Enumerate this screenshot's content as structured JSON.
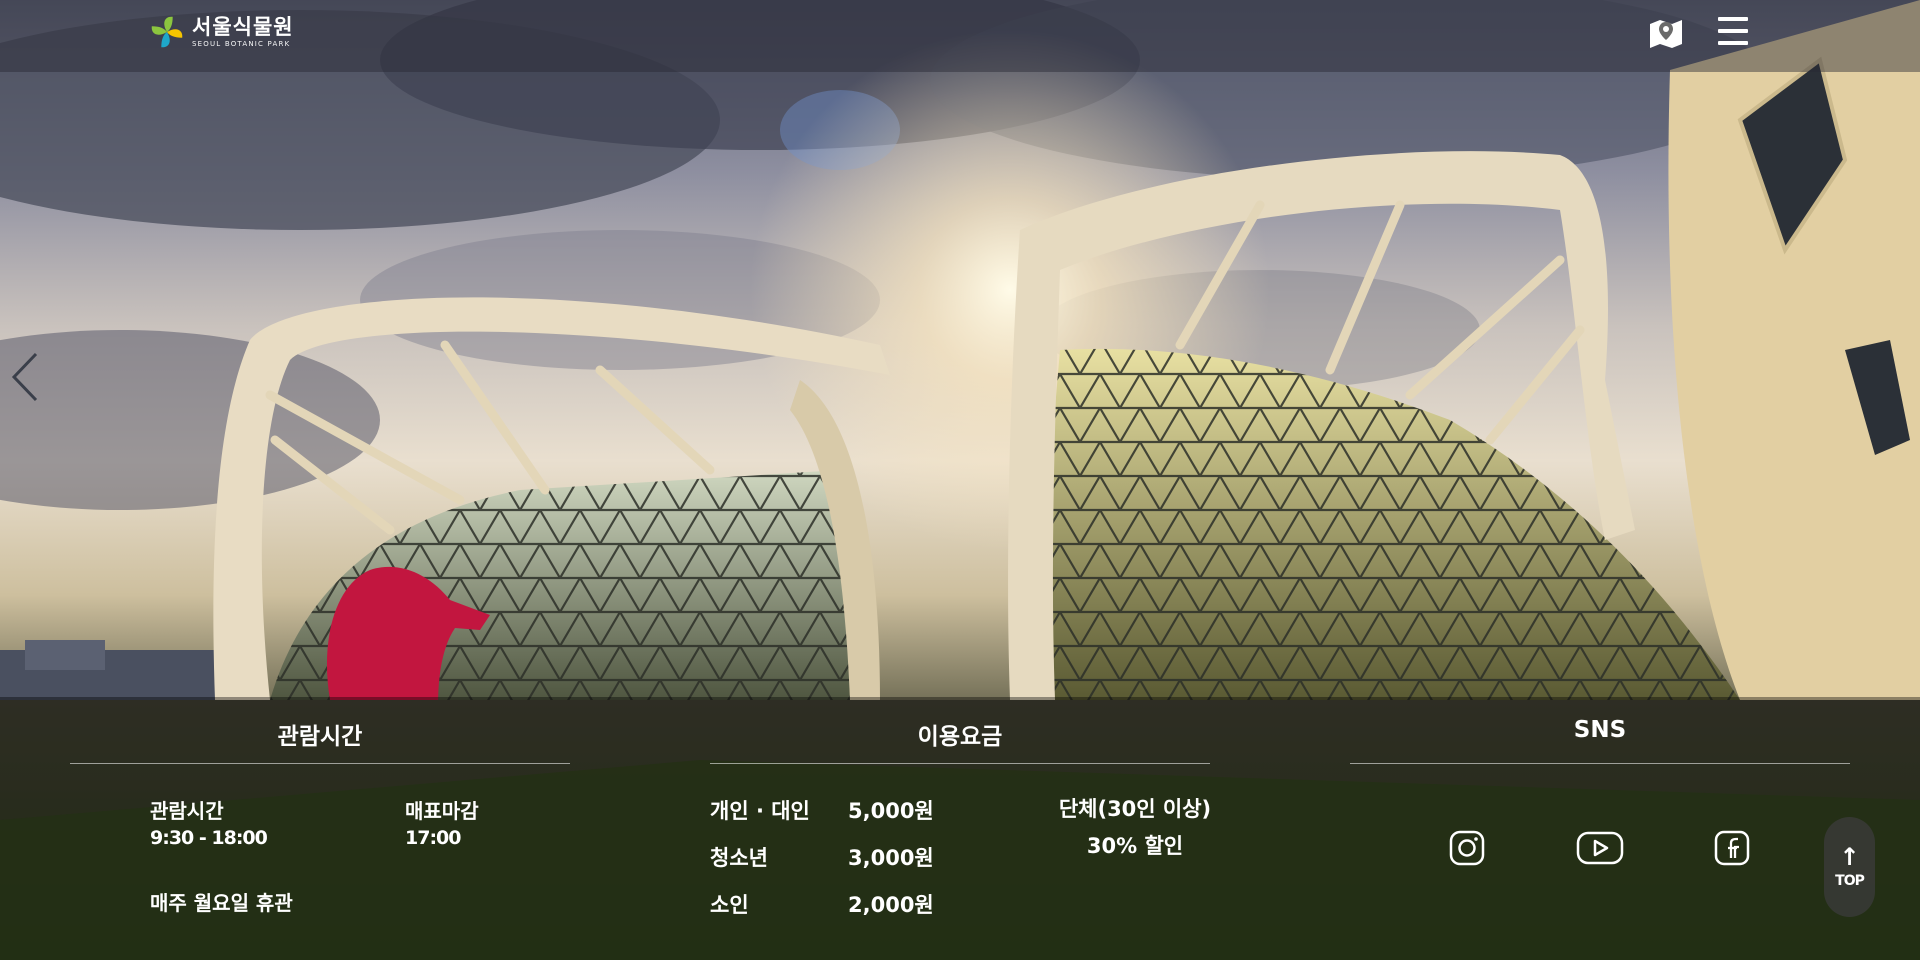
{
  "brand": {
    "name_ko": "서울식물원",
    "name_en": "SEOUL BOTANIC PARK",
    "accent_colors": [
      "#8cc63f",
      "#f5c400",
      "#1fa7c9"
    ]
  },
  "header": {
    "map_icon": "map-icon",
    "menu_icon": "hamburger-menu-icon"
  },
  "slider": {
    "prev_icon": "chevron-left-icon"
  },
  "hours": {
    "title": "관람시간",
    "open_label": "관람시간",
    "open_value": "9:30 - 18:00",
    "ticket_label": "매표마감",
    "ticket_value": "17:00",
    "closed_note": "매주 월요일 휴관"
  },
  "fees": {
    "title": "이용요금",
    "rows": [
      {
        "label": "개인 · 대인",
        "price": "5,000원"
      },
      {
        "label": "청소년",
        "price": "3,000원"
      },
      {
        "label": "소인",
        "price": "2,000원"
      }
    ],
    "group_label": "단체(30인 이상)",
    "group_discount": "30% 할인"
  },
  "sns": {
    "title": "SNS",
    "icons": [
      "instagram-icon",
      "youtube-icon",
      "facebook-icon"
    ]
  },
  "top_button": {
    "arrow": "↑",
    "label": "TOP"
  }
}
